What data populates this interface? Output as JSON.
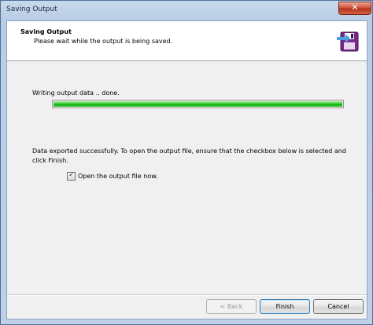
{
  "window": {
    "title": "Saving Output",
    "close_label": "✕"
  },
  "header": {
    "title": "Saving Output",
    "subtitle": "Please wait while the output is being saved.",
    "icon": "floppy-disk-save-icon"
  },
  "progress": {
    "status_text": "Writing output data .. done.",
    "percent": 100,
    "color": "#1cc41c"
  },
  "message": {
    "text": "Data exported successfully. To open the output file, ensure that the checkbox below is selected and click Finish."
  },
  "checkbox": {
    "label": "Open the output file now.",
    "checked": true
  },
  "buttons": {
    "back_label": "< Back",
    "finish_label": "Finish",
    "cancel_label": "Cancel"
  }
}
